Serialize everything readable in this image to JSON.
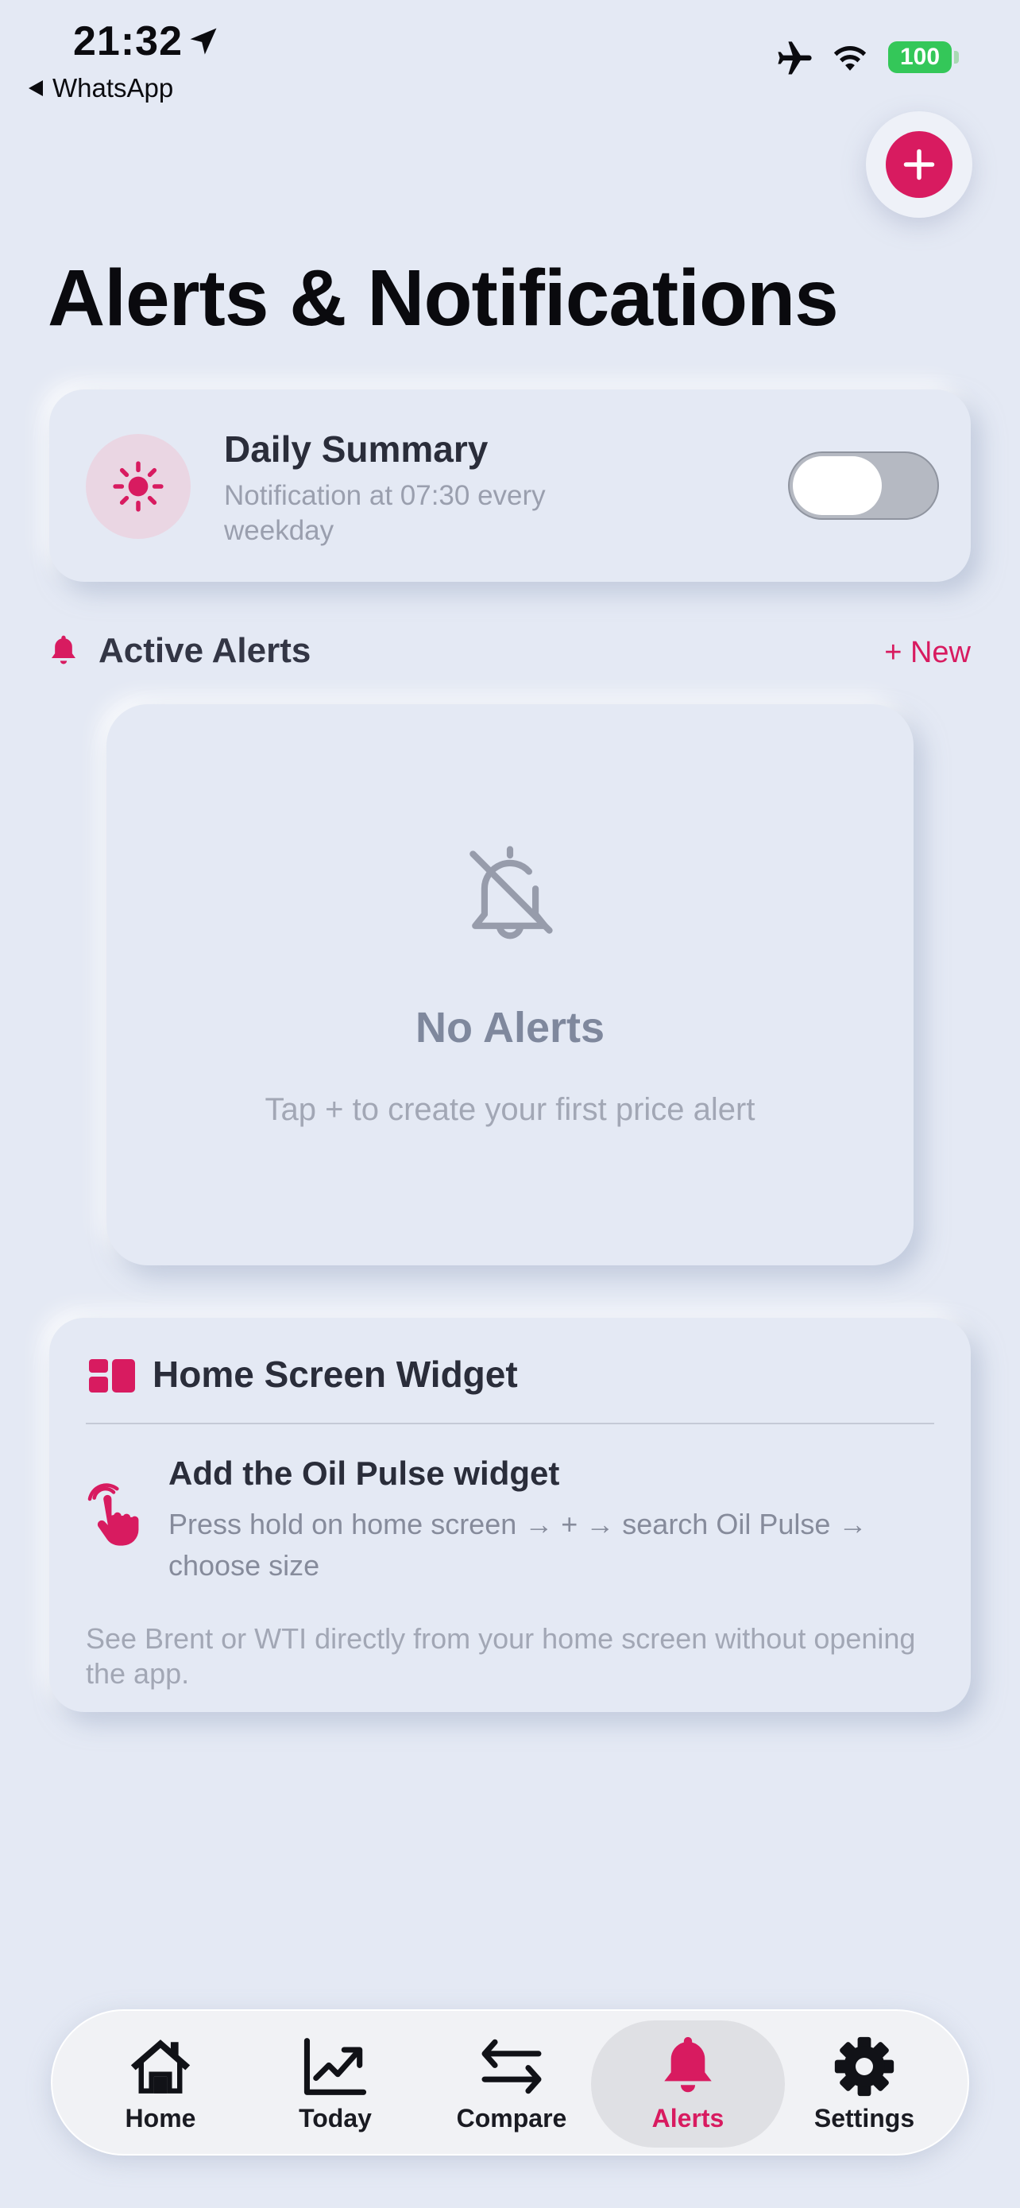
{
  "status_bar": {
    "time": "21:32",
    "back_app": "WhatsApp",
    "battery": "100"
  },
  "header": {
    "title": "Alerts & Notifications",
    "add_icon": "plus-icon"
  },
  "daily_summary": {
    "title": "Daily Summary",
    "subtitle": "Notification at 07:30 every weekday",
    "icon": "sun-icon",
    "enabled": false
  },
  "active_alerts": {
    "title": "Active Alerts",
    "new_label": "+ New",
    "empty_title": "No Alerts",
    "empty_subtitle": "Tap + to create your first price alert",
    "empty_icon": "bell-slash-icon"
  },
  "widget": {
    "title": "Home Screen Widget",
    "step_title": "Add the Oil Pulse widget",
    "step_subtitle": "Press hold on home screen → + → search Oil Pulse → choose size",
    "note": "See Brent or WTI directly from your home screen without opening the app."
  },
  "tabs": [
    {
      "label": "Home",
      "icon": "house-icon"
    },
    {
      "label": "Today",
      "icon": "chart-line-icon"
    },
    {
      "label": "Compare",
      "icon": "arrows-swap-icon"
    },
    {
      "label": "Alerts",
      "icon": "bell-icon",
      "active": true
    },
    {
      "label": "Settings",
      "icon": "gear-icon"
    }
  ],
  "colors": {
    "accent": "#d81b60",
    "background": "#e4e9f4"
  }
}
